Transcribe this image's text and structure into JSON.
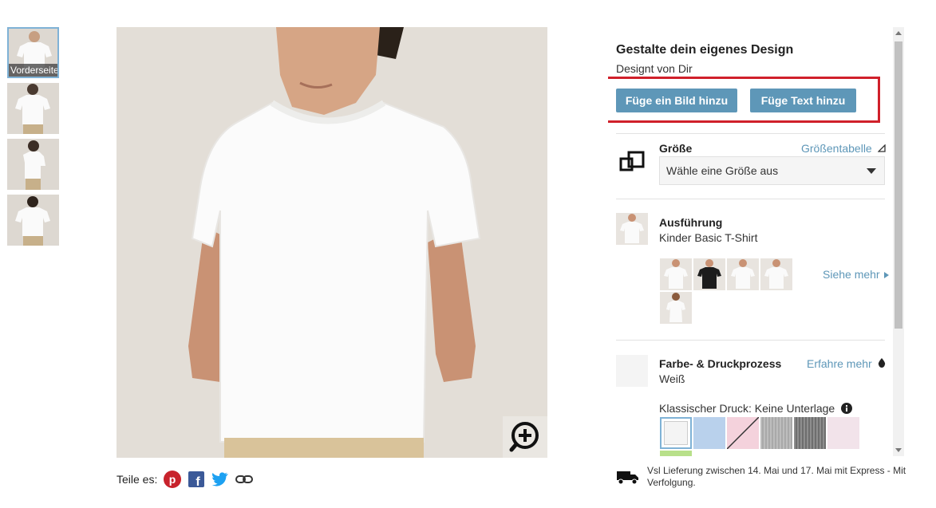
{
  "thumbnails": [
    {
      "label": "Vorderseite",
      "active": true
    },
    {
      "label": "",
      "active": false
    },
    {
      "label": "",
      "active": false
    },
    {
      "label": "",
      "active": false
    }
  ],
  "share": {
    "label": "Teile es:",
    "icons": [
      "pinterest-icon",
      "facebook-icon",
      "twitter-icon",
      "link-icon"
    ]
  },
  "design": {
    "title": "Gestalte dein eigenes Design",
    "subtitle": "Designt von Dir",
    "add_image_button": "Füge ein Bild hinzu",
    "add_text_button": "Füge Text hinzu"
  },
  "size": {
    "label": "Größe",
    "chart_link": "Größentabelle",
    "placeholder": "Wähle eine Größe aus"
  },
  "style": {
    "label": "Ausführung",
    "value": "Kinder Basic T-Shirt",
    "see_more": "Siehe mehr",
    "options": [
      "white-tee",
      "black-tee",
      "white-tee-2",
      "white-tee-3",
      "girl-white-tee"
    ]
  },
  "color": {
    "label": "Farbe- & Druckprozess",
    "learn_more": "Erfahre mehr",
    "value": "Weiß",
    "print_label": "Klassischer Druck: Keine Unterlage",
    "swatches": [
      "#f4f4f4",
      "#b9d1ec",
      "#f4d2dc",
      "#b3b3b3",
      "#8e8e8e",
      "#f2e3ea"
    ],
    "accent": "#5e97b8",
    "highlight": "#d0202a"
  },
  "delivery": {
    "text": "Vsl Lieferung zwischen 14. Mai und 17. Mai mit Express - Mit Verfolgung."
  }
}
